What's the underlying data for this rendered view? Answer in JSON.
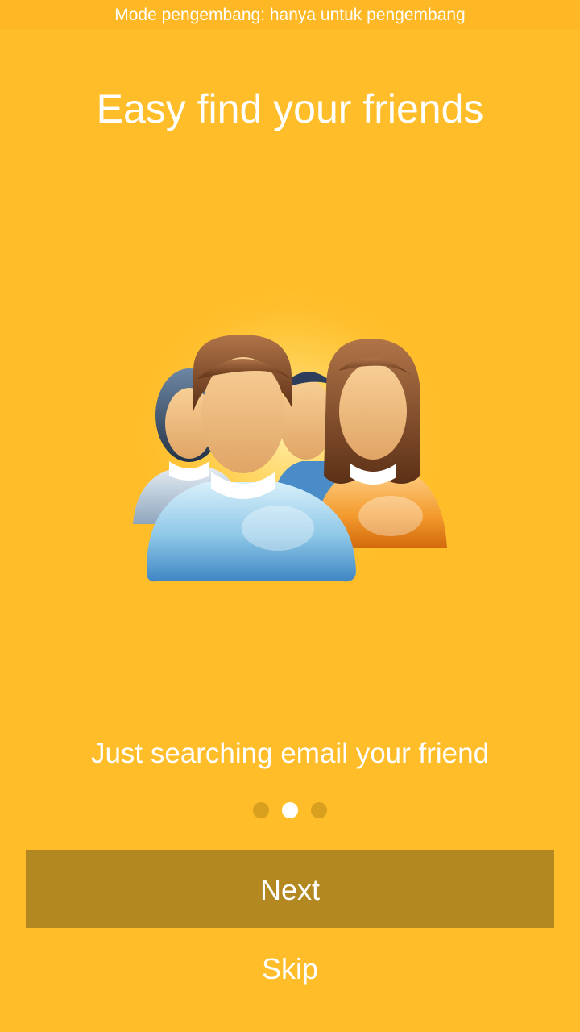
{
  "status_bar": {
    "text": "Mode pengembang: hanya untuk pengembang"
  },
  "onboarding": {
    "title": "Easy find your friends",
    "subtitle": "Just searching email your friend",
    "illustration_icon": "group-of-people-icon",
    "pages_total": 3,
    "current_page": 2
  },
  "actions": {
    "next_label": "Next",
    "skip_label": "Skip"
  },
  "colors": {
    "background": "#FFBD29",
    "button": "#B38821",
    "dot_inactive": "#D8A01E",
    "dot_active": "#FFFFFF"
  }
}
